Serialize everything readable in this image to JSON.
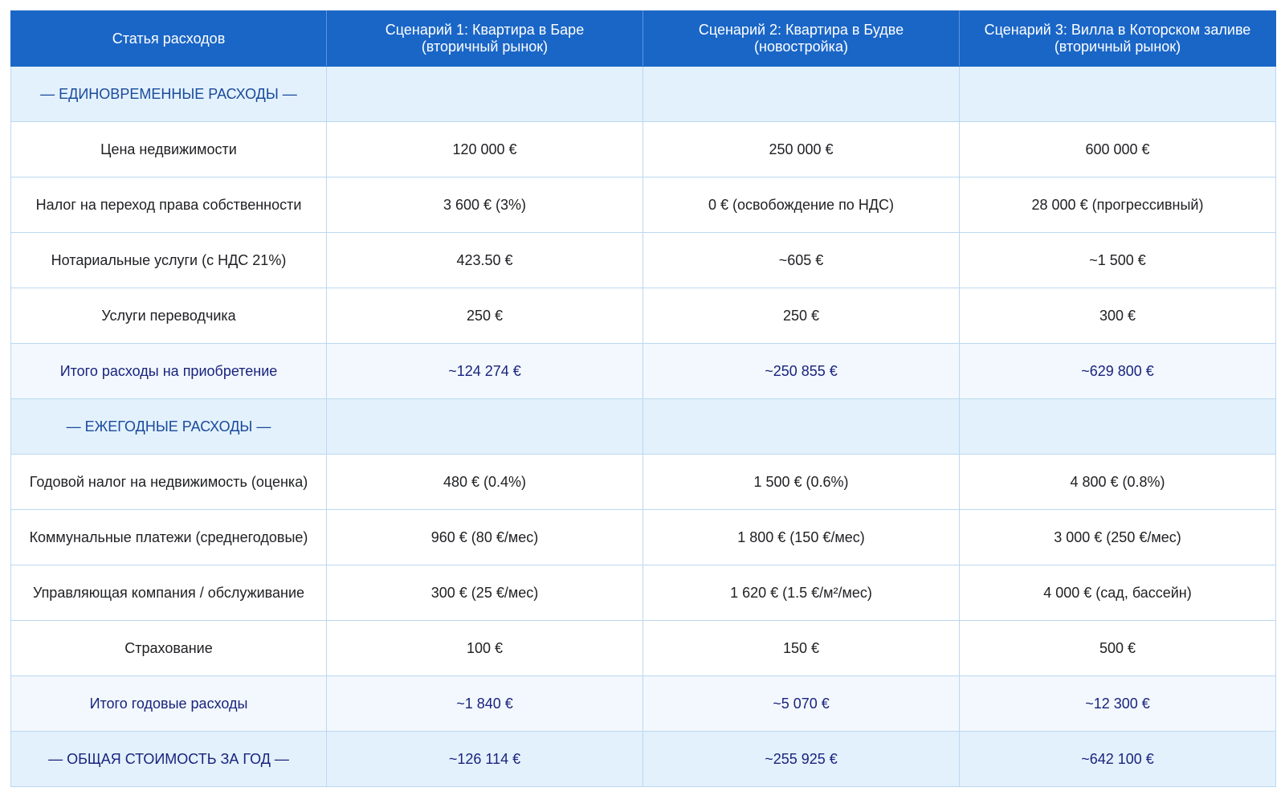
{
  "table": {
    "headers": [
      "Статья расходов",
      "Сценарий 1: Квартира в Баре\n(вторичный рынок)",
      "Сценарий 2: Квартира в Будве\n(новостройка)",
      "Сценарий 3: Вилла в Которском заливе\n(вторичный рынок)"
    ],
    "rows": [
      [
        "— ЕДИНОВРЕМЕННЫЕ РАСХОДЫ —",
        "",
        "",
        ""
      ],
      [
        "Цена недвижимости",
        "120 000 €",
        "250 000 €",
        "600 000 €"
      ],
      [
        "Налог на переход права собственности",
        "3 600 € (3%)",
        "0 € (освобождение по НДС)",
        "28 000 € (прогрессивный)"
      ],
      [
        "Нотариальные услуги (с НДС 21%)",
        "423.50 €",
        "~605 €",
        "~1 500 €"
      ],
      [
        "Услуги переводчика",
        "250 €",
        "250 €",
        "300 €"
      ],
      [
        "Итого расходы на приобретение",
        "~124 274 €",
        "~250 855 €",
        "~629 800 €"
      ],
      [
        "— ЕЖЕГОДНЫЕ РАСХОДЫ —",
        "",
        "",
        ""
      ],
      [
        "Годовой налог на недвижимость (оценка)",
        "480 € (0.4%)",
        "1 500 € (0.6%)",
        "4 800 € (0.8%)"
      ],
      [
        "Коммунальные платежи (среднегодовые)",
        "960 € (80 €/мес)",
        "1 800 € (150 €/мес)",
        "3 000 € (250 €/мес)"
      ],
      [
        "Управляющая компания / обслуживание",
        "300 € (25 €/мес)",
        "1 620 € (1.5 €/м²/мес)",
        "4 000 € (сад, бассейн)"
      ],
      [
        "Страхование",
        "100 €",
        "150 €",
        "500 €"
      ],
      [
        "Итого годовые расходы",
        "~1 840 €",
        "~5 070 €",
        "~12 300 €"
      ],
      [
        "— ОБЩАЯ СТОИМОСТЬ ЗА ГОД —",
        "~126 114 €",
        "~255 925 €",
        "~642 100 €"
      ]
    ]
  },
  "colors": {
    "header_bg": "#1a66c7",
    "section_bg": "#e3f1fc",
    "section_text": "#1a4a9c",
    "total_text": "#1a237e",
    "border": "#bcd8f0"
  }
}
